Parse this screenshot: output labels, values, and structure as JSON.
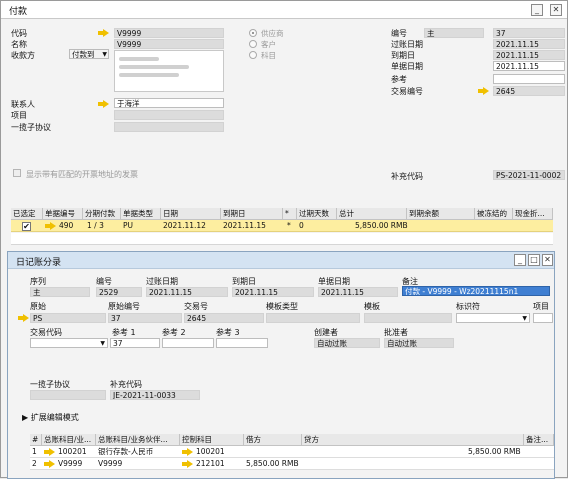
{
  "window": {
    "title": "付款"
  },
  "header_left": {
    "code_label": "代码",
    "code_value": "V9999",
    "name_label": "名称",
    "name_value": "V9999",
    "payee_label": "收款方",
    "payee_type": "付款到",
    "contact_label": "联系人",
    "contact_value": "于海洋",
    "project_label": "项目",
    "project_value": "",
    "agreement_label": "一揽子协议",
    "agreement_value": ""
  },
  "radios": {
    "supplier": "供应商",
    "customer": "客户",
    "account": "科目"
  },
  "header_right": {
    "number_label": "编号",
    "number_series": "主",
    "number_value": "37",
    "posting_date_label": "过账日期",
    "posting_date": "2021.11.15",
    "due_date_label": "到期日",
    "due_date": "2021.11.15",
    "doc_date_label": "单据日期",
    "doc_date": "2021.11.15",
    "ref_label": "参考",
    "ref_value": "",
    "trans_no_label": "交易编号",
    "trans_no": "2645",
    "supp_code_label": "补充代码",
    "supp_code": "PS-2021-11-0002"
  },
  "checkbox_text": "显示带有匹配的开票地址的发票",
  "invoice_table": {
    "columns": [
      "已选定",
      "单据编号",
      "分期付款",
      "单据类型",
      "日期",
      "到期日",
      "*",
      "过期天数",
      "总计",
      "到期余额",
      "被冻结的",
      "现金折..."
    ],
    "row": {
      "doc_no": "490",
      "installment": "1 / 3",
      "doc_type": "PU",
      "date": "2021.11.12",
      "due": "2021.11.15",
      "star": "*",
      "overdue": "0",
      "total": "5,850.00 RMB"
    }
  },
  "journal": {
    "title": "日记账分录",
    "series_label": "序列",
    "series_value": "主",
    "no_label": "编号",
    "no_value": "2529",
    "posting_label": "过账日期",
    "posting_value": "2021.11.15",
    "due_label": "到期日",
    "due_value": "2021.11.15",
    "doc_label": "单据日期",
    "doc_value": "2021.11.15",
    "remark_label": "备注",
    "remark_value": "付款 - V9999 - Wz20211115n1",
    "origin_label": "原始",
    "origin_value": "PS",
    "origin_no_label": "原始编号",
    "origin_no_value": "37",
    "trans_label": "交易号",
    "trans_value": "2645",
    "template_type_label": "模板类型",
    "template_label": "模板",
    "indicator_label": "标识符",
    "project_label": "项目",
    "trans_code_label": "交易代码",
    "ref1_label": "参考 1",
    "ref1_value": "37",
    "ref2_label": "参考 2",
    "ref3_label": "参考 3",
    "creator_label": "创建者",
    "creator_value": "自动过账",
    "approver_label": "批准者",
    "approver_value": "自动过账",
    "agreement_label": "一揽子协议",
    "supp_label": "补充代码",
    "supp_value": "JE-2021-11-0033",
    "expand_label": "扩展编辑模式",
    "lines_columns": [
      "#",
      "总账科目/业...",
      "总账科目/业务伙伴...",
      "控制科目",
      "借方",
      "贷方",
      "备注..."
    ],
    "lines": [
      {
        "no": "1",
        "account": "100201",
        "name": "银行存款-人民币",
        "control": "100201",
        "debit": "",
        "credit": "5,850.00 RMB"
      },
      {
        "no": "2",
        "account": "V9999",
        "name": "V9999",
        "control": "212101",
        "debit": "5,850.00 RMB",
        "credit": ""
      }
    ]
  }
}
